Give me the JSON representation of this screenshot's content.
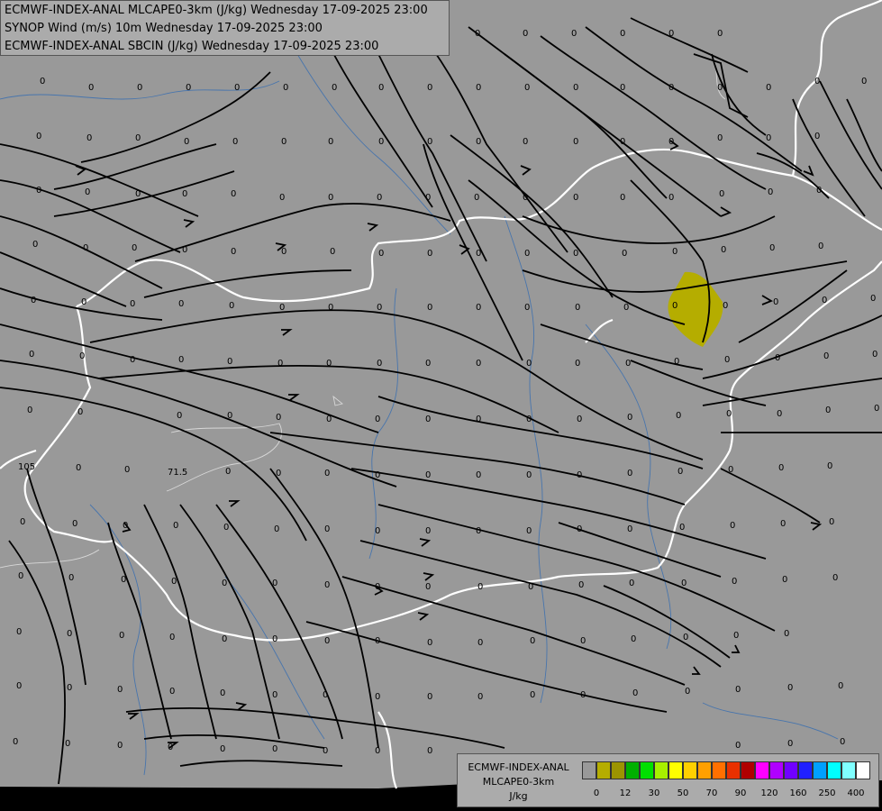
{
  "map": {
    "info_lines": [
      "ECMWF-INDEX-ANAL MLCAPE0-3km (J/kg) Wednesday 17-09-2025 23:00",
      "SYNOP Wind (m/s) 10m Wednesday 17-09-2025 23:00",
      "ECMWF-INDEX-ANAL SBCIN (J/kg) Wednesday 17-09-2025 23:00"
    ],
    "contour_labels": [
      "105",
      "71.5"
    ],
    "cin_value": "0",
    "cape_highlight_color": "#b5ad00",
    "border_color": "#ffffff",
    "background_color": "#999999"
  },
  "legend": {
    "title": [
      "ECMWF-INDEX-ANAL",
      "MLCAPE0-3km",
      "J/kg"
    ],
    "ticks": [
      "0",
      "12",
      "30",
      "50",
      "70",
      "90",
      "120",
      "160",
      "250",
      "400"
    ],
    "colors": [
      "#999999",
      "#b5ad00",
      "#9c9400",
      "#00b000",
      "#00e000",
      "#a8f000",
      "#ffff00",
      "#ffd000",
      "#ffa000",
      "#ff7000",
      "#e83000",
      "#b00000",
      "#ff00ff",
      "#b000ff",
      "#7000ff",
      "#2020ff",
      "#00a0ff",
      "#00ffff",
      "#80ffff",
      "#ffffff"
    ]
  }
}
